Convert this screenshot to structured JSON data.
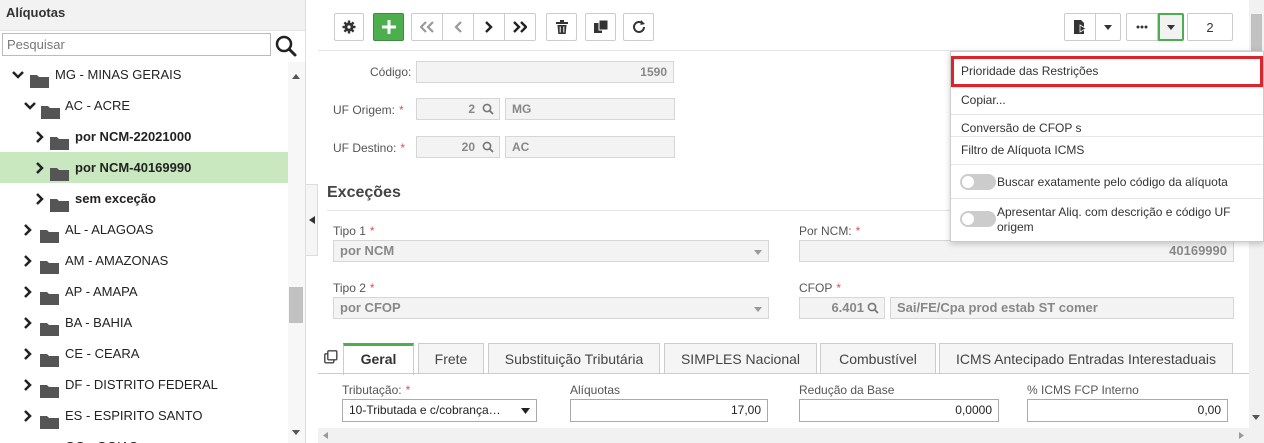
{
  "sidebar": {
    "title": "Alíquotas",
    "search_placeholder": "Pesquisar",
    "tree": [
      {
        "label": "MG - MINAS GERAIS"
      },
      {
        "label": "AC - ACRE"
      },
      {
        "label": "por NCM-22021000"
      },
      {
        "label": "por NCM-40169990"
      },
      {
        "label": "sem exceção"
      },
      {
        "label": "AL - ALAGOAS"
      },
      {
        "label": "AM - AMAZONAS"
      },
      {
        "label": "AP - AMAPA"
      },
      {
        "label": "BA - BAHIA"
      },
      {
        "label": "CE - CEARA"
      },
      {
        "label": "DF - DISTRITO FEDERAL"
      },
      {
        "label": "ES - ESPIRITO SANTO"
      },
      {
        "label": "GO - GOIAS"
      }
    ]
  },
  "toolbar": {
    "record_index": "2"
  },
  "form": {
    "codigo_label": "Código:",
    "codigo_value": "1590",
    "uf_origem_label": "UF Origem:",
    "uf_origem_code": "2",
    "uf_origem_value": "MG",
    "uf_destino_label": "UF Destino:",
    "uf_destino_code": "20",
    "uf_destino_value": "AC"
  },
  "excecoes": {
    "title": "Exceções",
    "tipo1_label": "Tipo 1",
    "tipo1_value": "por NCM",
    "por_ncm_label": "Por NCM:",
    "por_ncm_value": "40169990",
    "tipo2_label": "Tipo 2",
    "tipo2_value": "por CFOP",
    "cfop_label": "CFOP",
    "cfop_code": "6.401",
    "cfop_desc": "Sai/FE/Cpa prod estab ST comer"
  },
  "tabs": [
    {
      "label": "Geral"
    },
    {
      "label": "Frete"
    },
    {
      "label": "Substituição Tributária"
    },
    {
      "label": "SIMPLES Nacional"
    },
    {
      "label": "Combustível"
    },
    {
      "label": "ICMS Antecipado Entradas Interestaduais"
    }
  ],
  "geral": {
    "tributacao_label": "Tributação:",
    "tributacao_value": "10-Tributada e c/cobrança…",
    "aliquotas_label": "Alíquotas",
    "aliquotas_value": "17,00",
    "reducao_label": "Redução da Base",
    "reducao_value": "0,0000",
    "fcp_label": "% ICMS FCP Interno",
    "fcp_value": "0,00"
  },
  "menu": {
    "items": [
      {
        "label": "Prioridade das Restrições"
      },
      {
        "label": "Copiar..."
      },
      {
        "label": "Conversão de CFOP s"
      },
      {
        "label": "Filtro de Alíquota ICMS"
      }
    ],
    "toggle1_label": "Buscar exatamente pelo código da alíquota",
    "toggle2_label_line1": "Apresentar Aliq. com descrição e código UF",
    "toggle2_label_line2": "origem"
  },
  "colors": {
    "accent_green": "#4cae4c",
    "selected_row": "#c9e8c0",
    "highlight_red": "#d9262c"
  }
}
